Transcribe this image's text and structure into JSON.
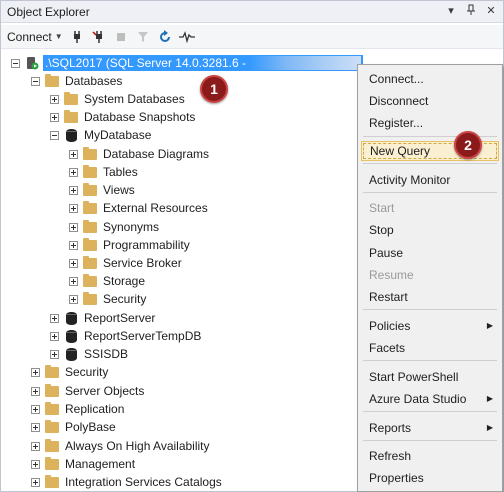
{
  "window": {
    "title": "Object Explorer",
    "title_icons": [
      "dropdown-icon",
      "pin-icon",
      "close-icon"
    ]
  },
  "toolbar": {
    "connect_label": "Connect",
    "icons": [
      "connect-plug-icon",
      "disconnect-plug-icon",
      "stop-icon",
      "filter-icon",
      "refresh-icon",
      "activity-icon"
    ]
  },
  "tree": {
    "root": {
      "label": ".\\SQL2017 (SQL Server 14.0.3281.6 -"
    },
    "databases_label": "Databases",
    "system_databases": "System Databases",
    "database_snapshots": "Database Snapshots",
    "mydatabase": "MyDatabase",
    "mydatabase_children": [
      "Database Diagrams",
      "Tables",
      "Views",
      "External Resources",
      "Synonyms",
      "Programmability",
      "Service Broker",
      "Storage",
      "Security"
    ],
    "other_databases": [
      "ReportServer",
      "ReportServerTempDB",
      "SSISDB"
    ],
    "server_nodes": [
      "Security",
      "Server Objects",
      "Replication",
      "PolyBase",
      "Always On High Availability",
      "Management",
      "Integration Services Catalogs"
    ]
  },
  "badges": [
    "1",
    "2"
  ],
  "context_menu": {
    "items": [
      {
        "label": "Connect...",
        "enabled": true
      },
      {
        "label": "Disconnect",
        "enabled": true
      },
      {
        "label": "Register...",
        "enabled": true
      },
      {
        "label": "New Query",
        "enabled": true,
        "highlighted": true
      },
      {
        "label": "Activity Monitor",
        "enabled": true
      },
      {
        "label": "Start",
        "enabled": false
      },
      {
        "label": "Stop",
        "enabled": true
      },
      {
        "label": "Pause",
        "enabled": true
      },
      {
        "label": "Resume",
        "enabled": false
      },
      {
        "label": "Restart",
        "enabled": true
      },
      {
        "label": "Policies",
        "enabled": true,
        "submenu": true
      },
      {
        "label": "Facets",
        "enabled": true
      },
      {
        "label": "Start PowerShell",
        "enabled": true
      },
      {
        "label": "Azure Data Studio",
        "enabled": true,
        "submenu": true
      },
      {
        "label": "Reports",
        "enabled": true,
        "submenu": true
      },
      {
        "label": "Refresh",
        "enabled": true
      },
      {
        "label": "Properties",
        "enabled": true
      }
    ]
  },
  "colors": {
    "selection": "#3399ff",
    "folder": "#dcb35c",
    "badge": "#8b1a1a",
    "menu_highlight": "#fbefd2"
  }
}
